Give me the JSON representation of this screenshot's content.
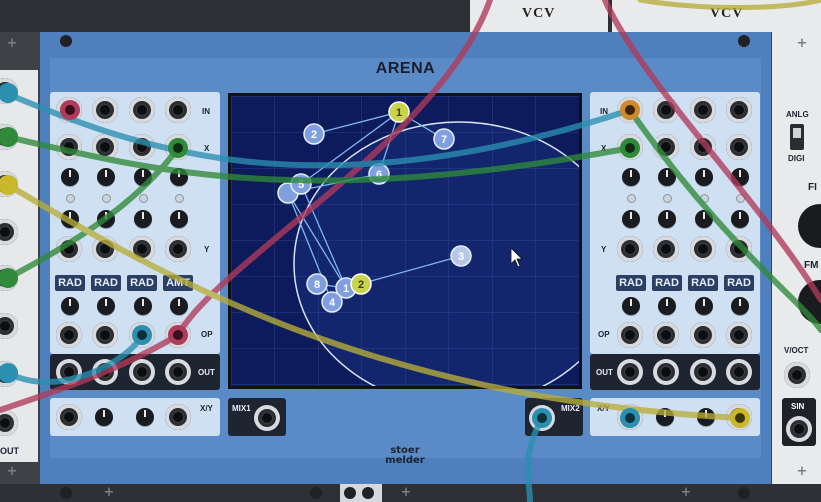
{
  "header": {
    "brand_left": "VCV",
    "brand_right": "VCV"
  },
  "arena": {
    "title": "ARENA",
    "brand_line1": "stoer",
    "brand_line2": "melder",
    "left_panel": {
      "in_label": "IN",
      "x_label": "X",
      "y_label": "Y",
      "op_label": "OP",
      "out_label": "OUT",
      "xy_label": "X/Y",
      "badges": [
        "RAD",
        "RAD",
        "RAD",
        "AMT"
      ]
    },
    "right_panel": {
      "in_label": "IN",
      "x_label": "X",
      "y_label": "Y",
      "op_label": "OP",
      "out_label": "OUT",
      "xy_label": "X/Y",
      "badges": [
        "RAD",
        "RAD",
        "RAD",
        "RAD"
      ]
    },
    "mix1_label": "MIX1",
    "mix2_label": "MIX2",
    "sources": [
      {
        "label": "1",
        "kind": "in"
      },
      {
        "label": "2",
        "kind": "in"
      },
      {
        "label": "3",
        "kind": "in"
      },
      {
        "label": "4",
        "kind": "in"
      },
      {
        "label": "5",
        "kind": "in"
      },
      {
        "label": "6",
        "kind": "in"
      },
      {
        "label": "7",
        "kind": "in"
      },
      {
        "label": "8",
        "kind": "in"
      }
    ],
    "mixers": [
      {
        "label": "1",
        "color": "#c9d44a"
      },
      {
        "label": "2",
        "color": "#c9d44a"
      }
    ]
  },
  "right_module": {
    "toggle_top": "ANLG",
    "toggle_bottom": "DIGI",
    "fi_label": "FI",
    "fm_label": "FM",
    "voct_label": "V/OCT",
    "sin_label": "SIN"
  },
  "left_module": {
    "out_label": "OUT"
  },
  "colors": {
    "panel_blue": "#4f7fbd",
    "screen_navy": "#0d1b5c",
    "source_blue": "#7f9fe0",
    "mixer_yellow": "#c9d44a",
    "cable_green": "#2f8a3a",
    "cable_yellow": "#b8ad3a",
    "cable_red": "#b03a5a",
    "cable_teal": "#2a8fb0"
  }
}
